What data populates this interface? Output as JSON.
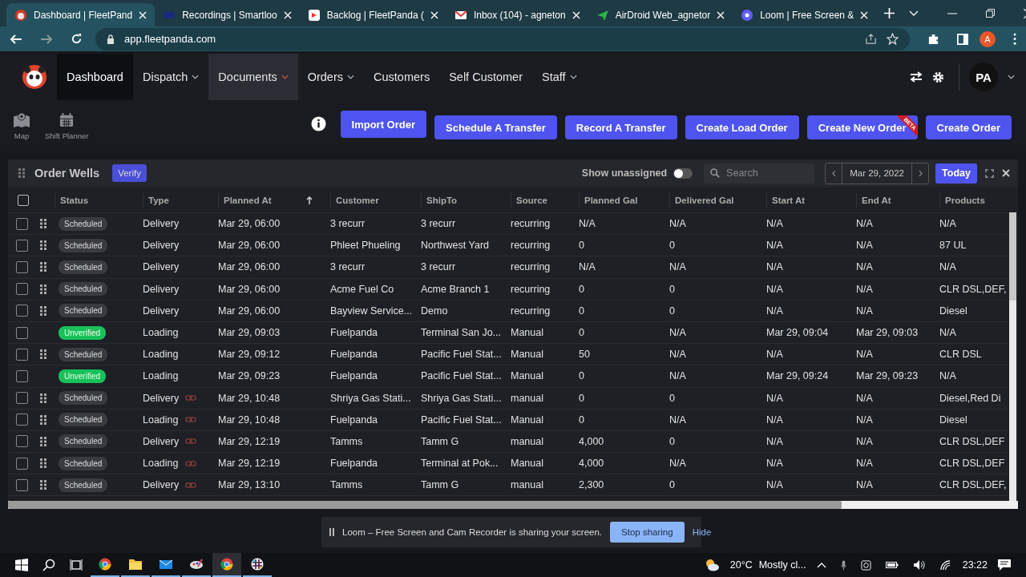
{
  "browser": {
    "tabs": [
      {
        "kind": "panda",
        "title": "Dashboard | FleetPand",
        "selected": true
      },
      {
        "kind": "video",
        "title": "Recordings | Smartloo",
        "selected": false
      },
      {
        "kind": "backlog",
        "title": "Backlog | FleetPanda (",
        "selected": false
      },
      {
        "kind": "mail",
        "title": "Inbox (104) - agneton",
        "selected": false
      },
      {
        "kind": "airdroid",
        "title": "AirDroid Web_agnetor",
        "selected": false
      },
      {
        "kind": "loom",
        "title": "Loom | Free Screen &",
        "selected": false
      }
    ],
    "url": "app.fleetpanda.com",
    "profile_initial": "A"
  },
  "nav": {
    "items": [
      {
        "label": "Dashboard",
        "dropdown": false,
        "selected": true,
        "hovered": false
      },
      {
        "label": "Dispatch",
        "dropdown": true,
        "selected": false,
        "hovered": false
      },
      {
        "label": "Documents",
        "dropdown": true,
        "selected": false,
        "hovered": true
      },
      {
        "label": "Orders",
        "dropdown": true,
        "selected": false,
        "hovered": false
      },
      {
        "label": "Customers",
        "dropdown": false,
        "selected": false,
        "hovered": false
      },
      {
        "label": "Self Customer",
        "dropdown": false,
        "selected": false,
        "hovered": false
      },
      {
        "label": "Staff",
        "dropdown": true,
        "selected": false,
        "hovered": false
      }
    ],
    "user_initials": "PA"
  },
  "tools": [
    {
      "kind": "map",
      "label": "Map"
    },
    {
      "kind": "calendar",
      "label": "Shift Planner"
    }
  ],
  "actions": [
    {
      "label": "Import Order"
    },
    {
      "label": "Schedule A Transfer"
    },
    {
      "label": "Record A Transfer"
    },
    {
      "label": "Create Load Order"
    },
    {
      "label": "Create New Order",
      "badge": "BETA"
    },
    {
      "label": "Create Order"
    }
  ],
  "panel": {
    "title": "Order Wells",
    "verify": "Verify",
    "unassigned_label": "Show unassigned",
    "unassigned_on": false,
    "search_placeholder": "Search",
    "date": "Mar 29, 2022",
    "today": "Today"
  },
  "table": {
    "all_checked": false,
    "columns": [
      {
        "label": "Status",
        "sorted": false
      },
      {
        "label": "Type",
        "sorted": false
      },
      {
        "label": "Planned At",
        "sorted": true
      },
      {
        "label": "Customer",
        "sorted": false
      },
      {
        "label": "ShipTo",
        "sorted": false
      },
      {
        "label": "Source",
        "sorted": false
      },
      {
        "label": "Planned Gal",
        "sorted": false
      },
      {
        "label": "Delivered Gal",
        "sorted": false
      },
      {
        "label": "Start At",
        "sorted": false
      },
      {
        "label": "End At",
        "sorted": false
      },
      {
        "label": "Products",
        "sorted": false
      }
    ],
    "rows": [
      {
        "checked": false,
        "kind": "scheduled",
        "linked": false,
        "cells": [
          "Scheduled",
          "Delivery",
          "Mar 29, 06:00",
          "3 recurr",
          "3 recurr",
          "recurring",
          "N/A",
          "N/A",
          "N/A",
          "N/A",
          "N/A"
        ]
      },
      {
        "checked": false,
        "kind": "scheduled",
        "linked": false,
        "cells": [
          "Scheduled",
          "Delivery",
          "Mar 29, 06:00",
          "Phleet Phueling",
          "Northwest Yard",
          "recurring",
          "0",
          "0",
          "N/A",
          "N/A",
          "87 UL"
        ]
      },
      {
        "checked": false,
        "kind": "scheduled",
        "linked": false,
        "cells": [
          "Scheduled",
          "Delivery",
          "Mar 29, 06:00",
          "3 recurr",
          "3 recurr",
          "recurring",
          "N/A",
          "N/A",
          "N/A",
          "N/A",
          "N/A"
        ]
      },
      {
        "checked": false,
        "kind": "scheduled",
        "linked": false,
        "cells": [
          "Scheduled",
          "Delivery",
          "Mar 29, 06:00",
          "Acme Fuel Co",
          "Acme Branch 1",
          "recurring",
          "0",
          "0",
          "N/A",
          "N/A",
          "CLR DSL,DEF,"
        ]
      },
      {
        "checked": false,
        "kind": "scheduled",
        "linked": false,
        "cells": [
          "Scheduled",
          "Delivery",
          "Mar 29, 06:00",
          "Bayview Service...",
          "Demo",
          "recurring",
          "0",
          "0",
          "N/A",
          "N/A",
          "Diesel"
        ]
      },
      {
        "checked": false,
        "kind": "unverified",
        "linked": false,
        "cells": [
          "Unverified",
          "Loading",
          "Mar 29, 09:03",
          "Fuelpanda",
          "Terminal San Jo...",
          "Manual",
          "0",
          "N/A",
          "Mar 29, 09:04",
          "Mar 29, 09:03",
          "N/A"
        ]
      },
      {
        "checked": false,
        "kind": "scheduled",
        "linked": false,
        "cells": [
          "Scheduled",
          "Loading",
          "Mar 29, 09:12",
          "Fuelpanda",
          "Pacific Fuel Stat...",
          "Manual",
          "50",
          "N/A",
          "N/A",
          "N/A",
          "CLR DSL"
        ]
      },
      {
        "checked": false,
        "kind": "unverified",
        "linked": false,
        "cells": [
          "Unverified",
          "Loading",
          "Mar 29, 09:23",
          "Fuelpanda",
          "Pacific Fuel Stat...",
          "Manual",
          "0",
          "N/A",
          "Mar 29, 09:24",
          "Mar 29, 09:23",
          "N/A"
        ]
      },
      {
        "checked": false,
        "kind": "scheduled",
        "linked": true,
        "cells": [
          "Scheduled",
          "Delivery",
          "Mar 29, 10:48",
          "Shriya Gas Stati...",
          "Shriya Gas Stati...",
          "manual",
          "0",
          "0",
          "N/A",
          "N/A",
          "Diesel,Red Di"
        ]
      },
      {
        "checked": false,
        "kind": "scheduled",
        "linked": true,
        "cells": [
          "Scheduled",
          "Loading",
          "Mar 29, 10:48",
          "Fuelpanda",
          "Pacific Fuel Stat...",
          "Manual",
          "0",
          "N/A",
          "N/A",
          "N/A",
          "Diesel"
        ]
      },
      {
        "checked": false,
        "kind": "scheduled",
        "linked": true,
        "cells": [
          "Scheduled",
          "Delivery",
          "Mar 29, 12:19",
          "Tamms",
          "Tamm G",
          "manual",
          "4,000",
          "0",
          "N/A",
          "N/A",
          "CLR DSL,DEF"
        ]
      },
      {
        "checked": false,
        "kind": "scheduled",
        "linked": true,
        "cells": [
          "Scheduled",
          "Loading",
          "Mar 29, 12:19",
          "Fuelpanda",
          "Terminal at Pok...",
          "Manual",
          "4,000",
          "N/A",
          "N/A",
          "N/A",
          "CLR DSL,DEF"
        ]
      },
      {
        "checked": false,
        "kind": "scheduled",
        "linked": true,
        "cells": [
          "Scheduled",
          "Delivery",
          "Mar 29, 13:10",
          "Tamms",
          "Tamm G",
          "manual",
          "2,300",
          "0",
          "N/A",
          "N/A",
          "CLR DSL,DEF,"
        ]
      }
    ]
  },
  "sharing_bar": {
    "message": "Loom – Free Screen and Cam Recorder is sharing your screen.",
    "stop": "Stop sharing",
    "hide": "Hide"
  },
  "taskbar": {
    "apps": [
      {
        "kind": "chrome",
        "selected": false
      },
      {
        "kind": "folder",
        "selected": false
      },
      {
        "kind": "mail",
        "selected": false
      },
      {
        "kind": "paint",
        "selected": false
      },
      {
        "kind": "chrome",
        "selected": true
      },
      {
        "kind": "slack",
        "selected": false
      }
    ],
    "temperature": "20°C",
    "weather": "Mostly cl...",
    "time": "23:22"
  }
}
